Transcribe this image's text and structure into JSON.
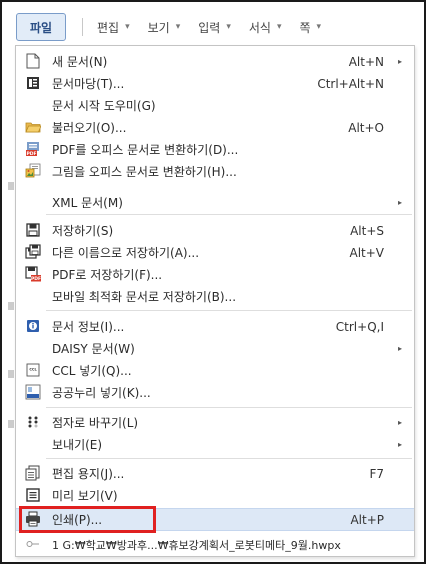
{
  "menubar": {
    "file_label": "파일",
    "items": [
      {
        "label": "편집",
        "caret": "▾"
      },
      {
        "label": "보기",
        "caret": "▾"
      },
      {
        "label": "입력",
        "caret": "▾"
      },
      {
        "label": "서식",
        "caret": "▾"
      },
      {
        "label": "쪽",
        "caret": "▾"
      }
    ]
  },
  "menu": {
    "new_doc": {
      "label": "새 문서(N)",
      "shortcut": "Alt+N",
      "icon": "new-doc-icon",
      "has_submenu": true
    },
    "doc_template": {
      "label": "문서마당(T)...",
      "shortcut": "Ctrl+Alt+N",
      "icon": "template-icon"
    },
    "doc_start_help": {
      "label": "문서 시작 도우미(G)"
    },
    "open": {
      "label": "불러오기(O)...",
      "shortcut": "Alt+O",
      "icon": "folder-icon"
    },
    "pdf_convert": {
      "label": "PDF를 오피스 문서로 변환하기(D)...",
      "icon": "pdf-convert-icon"
    },
    "image_convert": {
      "label": "그림을 오피스 문서로 변환하기(H)...",
      "icon": "image-convert-icon"
    },
    "xml_doc": {
      "label": "XML 문서(M)",
      "has_submenu": true
    },
    "save": {
      "label": "저장하기(S)",
      "shortcut": "Alt+S",
      "icon": "save-icon"
    },
    "save_as": {
      "label": "다른 이름으로 저장하기(A)...",
      "shortcut": "Alt+V",
      "icon": "save-as-icon"
    },
    "save_pdf": {
      "label": "PDF로 저장하기(F)...",
      "icon": "save-pdf-icon"
    },
    "save_mobile": {
      "label": "모바일 최적화 문서로 저장하기(B)..."
    },
    "doc_info": {
      "label": "문서 정보(I)...",
      "shortcut": "Ctrl+Q,I",
      "icon": "info-icon"
    },
    "daisy_doc": {
      "label": "DAISY 문서(W)",
      "has_submenu": true
    },
    "ccl_insert": {
      "label": "CCL 넣기(Q)...",
      "icon": "ccl-icon"
    },
    "kogl_insert": {
      "label": "공공누리 넣기(K)...",
      "icon": "kogl-icon"
    },
    "braille": {
      "label": "점자로 바꾸기(L)",
      "icon": "braille-icon",
      "has_submenu": true
    },
    "send": {
      "label": "보내기(E)",
      "has_submenu": true
    },
    "page_setup": {
      "label": "편집 용지(J)...",
      "shortcut": "F7",
      "icon": "page-setup-icon"
    },
    "preview": {
      "label": "미리 보기(V)",
      "icon": "preview-icon"
    },
    "print": {
      "label": "인쇄(P)...",
      "shortcut": "Alt+P",
      "icon": "printer-icon"
    },
    "recent_file": {
      "label": "1 G:₩학교₩방과후...₩휴보강계획서_로봇티메타_9월.hwpx",
      "icon": "pin-icon"
    }
  },
  "colors": {
    "accent": "#2a4e85",
    "highlight": "#dde8f6",
    "annotation": "#e02020"
  }
}
